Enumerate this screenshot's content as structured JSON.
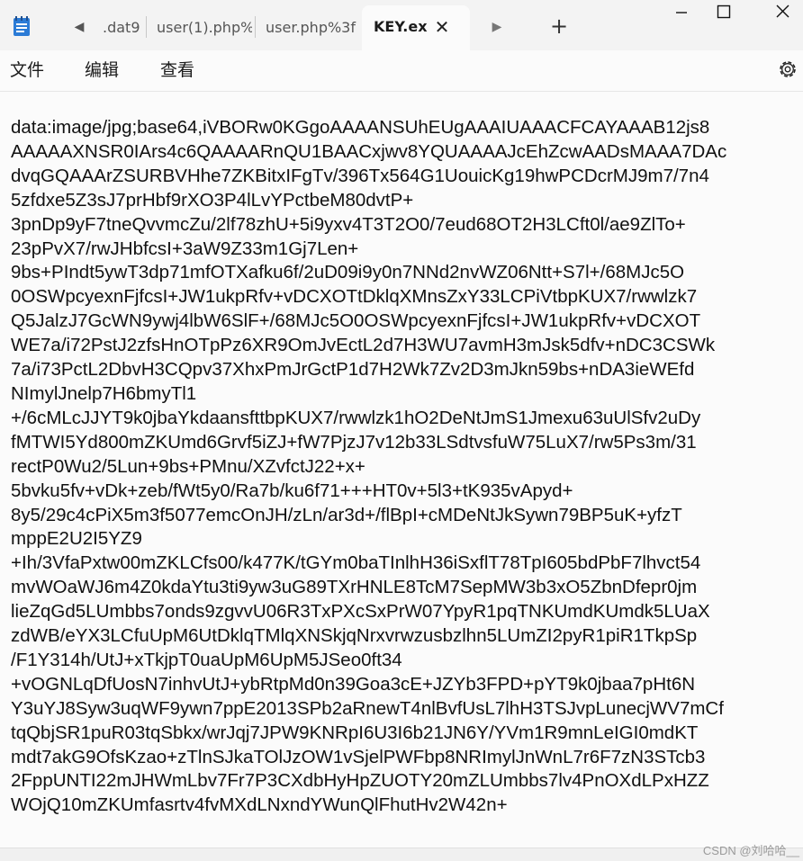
{
  "tabs": [
    {
      "label": ".dat9",
      "active": false
    },
    {
      "label": "user(1).php%",
      "active": false
    },
    {
      "label": "user.php%3f",
      "active": false
    },
    {
      "label": "KEY.ex",
      "active": true
    }
  ],
  "new_tab_label": "+",
  "menu": {
    "file": "文件",
    "edit": "编辑",
    "view": "查看"
  },
  "editor": {
    "lines": [
      "data:image/jpg;base64,iVBORw0KGgoAAAANSUhEUgAAAIUAAACFCAYAAAB12js8",
      "AAAAAXNSR0IArs4c6QAAAARnQU1BAACxjwv8YQUAAAAJcEhZcwAADsMAAA7DAc",
      "dvqGQAAArZSURBVHhe7ZKBitxIFgTv/396Tx564G1UouicKg19hwPCDcrMJ9m7/7n4",
      "5zfdxe5Z3sJ7prHbf9rXO3P4lLvYPctbeM80dvtP+",
      "3pnDp9yF7tneQvvmcZu/2lf78zhU+5i9yxv4T3T2O0/7eud68OT2H3LCft0l/ae9ZlTo+",
      "23pPvX7/rwJHbfcsI+3aW9Z33m1Gj7Len+",
      "9bs+PIndt5ywT3dp71mfOTXafku6f/2uD09i9y0n7NNd2nvWZ06Ntt+S7l+/68MJc5O",
      "0OSWpcyexnFjfcsI+JW1ukpRfv+vDCXOTtDklqXMnsZxY33LCPiVtbpKUX7/rwwlzk7",
      "Q5JalzJ7GcWN9ywj4lbW6SlF+/68MJc5O0OSWpcyexnFjfcsI+JW1ukpRfv+vDCXOT",
      "WE7a/i72PstJ2zfsHnOTpPz6XR9OmJvEctL2d7H3WU7avmH3mJsk5dfv+nDC3CSWk",
      "7a/i73PctL2DbvH3CQpv37XhxPmJrGctP1d7H2Wk7Zv2D3mJkn59bs+nDA3ieWEfd",
      "NImylJnelp7H6bmyTl1",
      "+/6cMLcJJYT9k0jbaYkdaansfttbpKUX7/rwwlzk1hO2DeNtJmS1Jmexu63uUlSfv2uDy",
      "fMTWI5Yd800mZKUmd6Grvf5iZJ+fW7PjzJ7v12b33LSdtvsfuW75LuX7/rw5Ps3m/31",
      "rectP0Wu2/5Lun+9bs+PMnu/XZvfctJ22+x+",
      "5bvku5fv+vDk+zeb/fWt5y0/Ra7b/ku6f71+++HT0v+5l3+tK935vApyd+",
      "8y5/29c4cPiX5m3f5077emcOnJH/zLn/ar3d+/flBpI+cMDeNtJkSywn79BP5uK+yfzT",
      "mppE2U2I5YZ9",
      "+Ih/3VfaPxtw00mZKLCfs00/k477K/tGYm0baTInlhH36iSxflT78TpI605bdPbF7lhvct54",
      "mvWOaWJ6m4Z0kdaYtu3ti9yw3uG89TXrHNLE8TcM7SepMW3b3xO5ZbnDfepr0jm",
      "lieZqGd5LUmbbs7onds9zgvvU06R3TxPXcSxPrW07YpyR1pqTNKUmdKUmdk5LUaX",
      "zdWB/eYX3LCfuUpM6UtDklqTMlqXNSkjqNrxvrwzusbzlhn5LUmZI2pyR1piR1TkpSp",
      "/F1Y314h/UtJ+xTkjpT0uaUpM6UpM5JSeo0ft34",
      "+vOGNLqDfUosN7inhvUtJ+ybRtpMd0n39Goa3cE+JZYb3FPD+pYT9k0jbaa7pHt6N",
      "Y3uYJ8Syw3uqWF9ywn7ppE2013SPb2aRnewT4nlBvfUsL7lhH3TSJvpLunecjWV7mCf",
      "tqQbjSR1puR03tqSbkx/wrJqj7JPW9KNRpI6U3I6b21JN6Y/YVm1R9mnLeIGI0mdKT",
      "mdt7akG9OfsKzao+zTlnSJkaTOlJzOW1vSjelPWFbp8NRImylJnWnL7r6F7zN3STcb3",
      "2FppUNTI22mJHWmLbv7Fr7P3CXdbHyHpZUOTY20mZLUmbbs7lv4PnOXdLPxHZZ",
      "WOjQ10mZKUmfasrtv4fvMXdLNxndYWunQlFhutHv2W42n+"
    ]
  },
  "watermark": "CSDN @刘哈哈__"
}
